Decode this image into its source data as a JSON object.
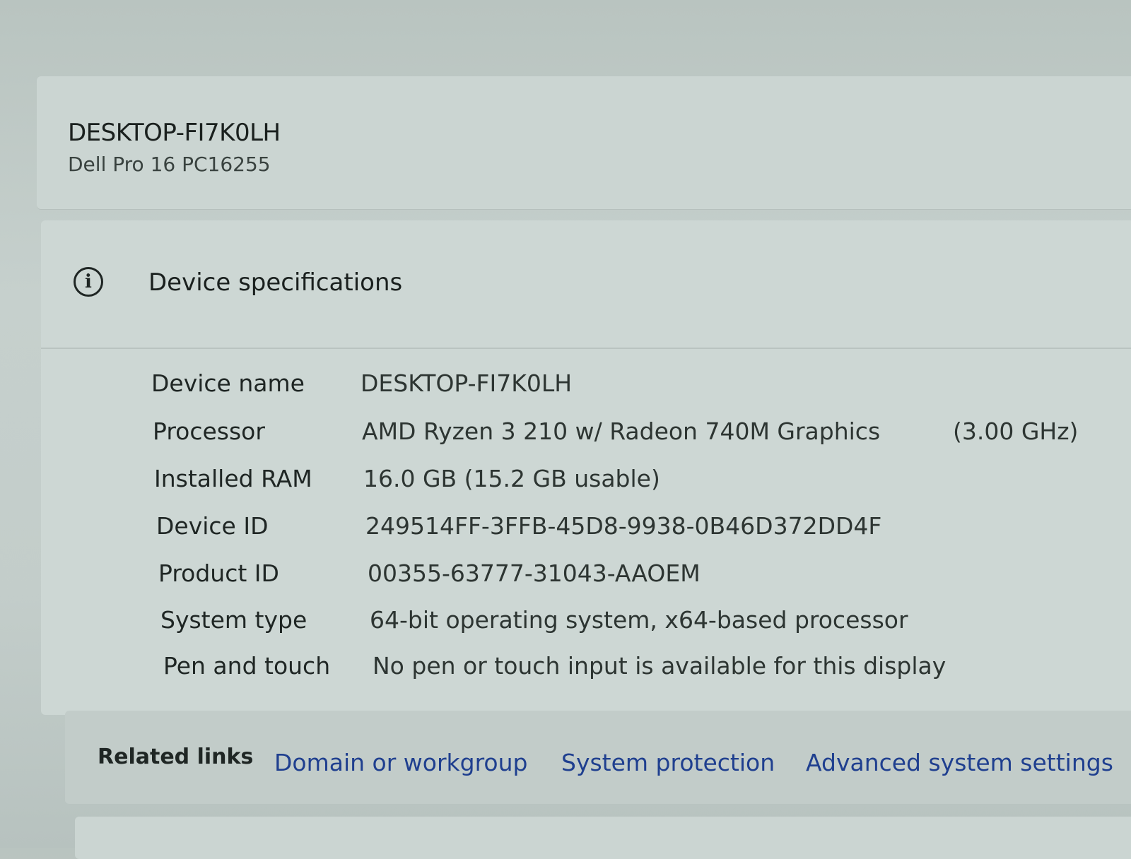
{
  "system": {
    "device_name_heading": "DESKTOP-FI7K0LH",
    "model": "Dell Pro 16 PC16255"
  },
  "specs": {
    "title": "Device specifications",
    "icon": "info-icon",
    "rows": [
      {
        "label": "Device name",
        "value": "DESKTOP-FI7K0LH"
      },
      {
        "label": "Processor",
        "value": "AMD Ryzen 3 210 w/ Radeon 740M Graphics",
        "extra": "(3.00 GHz)"
      },
      {
        "label": "Installed RAM",
        "value": "16.0 GB (15.2 GB usable)"
      },
      {
        "label": "Device ID",
        "value": "249514FF-3FFB-45D8-9938-0B46D372DD4F"
      },
      {
        "label": "Product ID",
        "value": "00355-63777-31043-AAOEM"
      },
      {
        "label": "System type",
        "value": "64-bit operating system, x64-based processor"
      },
      {
        "label": "Pen and touch",
        "value": "No pen or touch input is available for this display"
      }
    ]
  },
  "related_links": {
    "label": "Related links",
    "links": [
      "Domain or workgroup",
      "System protection",
      "Advanced system settings"
    ]
  },
  "colors": {
    "link": "#1f3f8f",
    "card": "#cdd7d4",
    "background": "#c6d0cd"
  }
}
